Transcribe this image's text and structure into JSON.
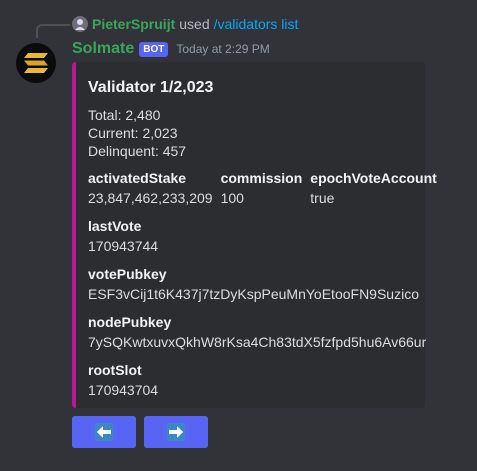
{
  "reply": {
    "username": "PieterSpruijt",
    "action": "used",
    "command": "/validators list"
  },
  "message": {
    "bot_name": "Solmate",
    "bot_tag": "BOT",
    "timestamp": "Today at 2:29 PM"
  },
  "embed": {
    "title": "Validator 1/2,023",
    "description": [
      "Total: 2,480",
      "Current: 2,023",
      "Delinquent: 457"
    ],
    "accent_color": "#b61994",
    "fields": {
      "activatedStake": {
        "name": "activatedStake",
        "value": "23,847,462,233,209"
      },
      "commission": {
        "name": "commission",
        "value": "100"
      },
      "epochVoteAccount": {
        "name": "epochVoteAccount",
        "value": "true"
      },
      "lastVote": {
        "name": "lastVote",
        "value": "170943744"
      },
      "votePubkey": {
        "name": "votePubkey",
        "value": "ESF3vCij1t6K437j7tzDyKspPeuMnYoEtooFN9Suzico"
      },
      "nodePubkey": {
        "name": "nodePubkey",
        "value": "7ySQKwtxuvxQkhW8rKsa4Ch83tdX5fzfpd5hu6Av66ur"
      },
      "rootSlot": {
        "name": "rootSlot",
        "value": "170943704"
      }
    }
  },
  "buttons": {
    "prev_icon": "left-arrow-icon",
    "next_icon": "right-arrow-icon",
    "color": "#5865f2"
  }
}
